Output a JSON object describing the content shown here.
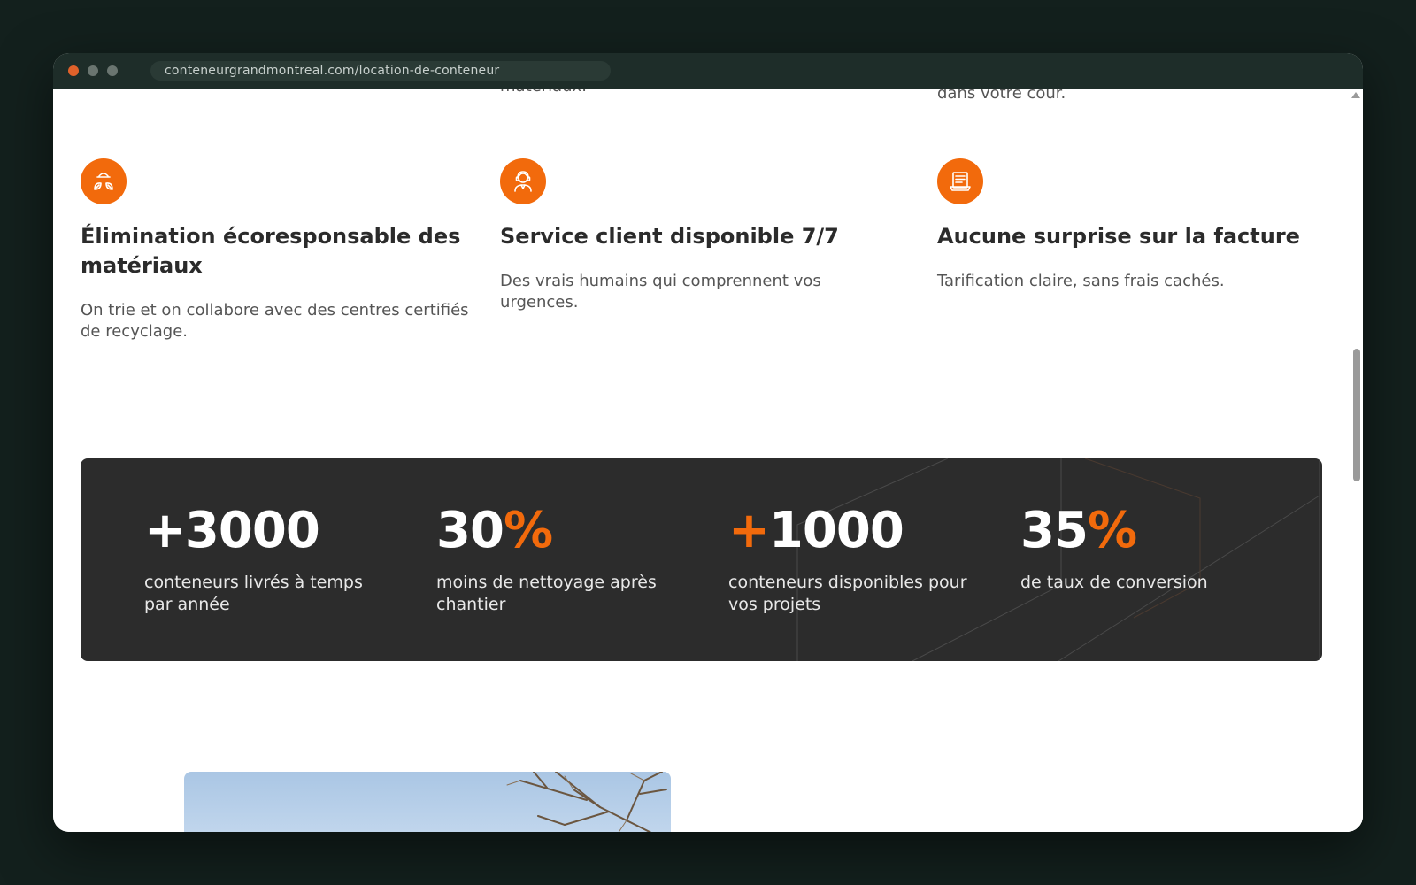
{
  "browser": {
    "url": "conteneurgrandmontreal.com/location-de-conteneur"
  },
  "partial_text": {
    "col2": "matériaux.",
    "col3": "dans votre cour."
  },
  "features": [
    {
      "icon": "recycle-icon",
      "title": "Élimination écoresponsable des matériaux",
      "text": "On trie et on collabore avec des centres certifiés de recyclage."
    },
    {
      "icon": "support-agent-icon",
      "title": "Service client disponible 7/7",
      "text": "Des vrais humains qui comprennent vos urgences."
    },
    {
      "icon": "invoice-icon",
      "title": "Aucune surprise sur la facture",
      "text": "Tarification claire, sans frais cachés."
    }
  ],
  "stats": [
    {
      "prefix": "+",
      "value": "3000",
      "suffix": "",
      "label": "conteneurs livrés à temps par année"
    },
    {
      "prefix": "",
      "value": "30",
      "suffix": "%",
      "label": "moins de nettoyage après chantier"
    },
    {
      "prefix": "+",
      "value": "1000",
      "suffix": "",
      "label": "conteneurs disponibles pour vos projets"
    },
    {
      "prefix": "",
      "value": "35",
      "suffix": "%",
      "label": "de taux de conversion"
    }
  ],
  "colors": {
    "accent": "#f26a0c",
    "stats_bg": "#2c2c2c",
    "heading": "#2b2b2b",
    "body_text": "#555555"
  }
}
